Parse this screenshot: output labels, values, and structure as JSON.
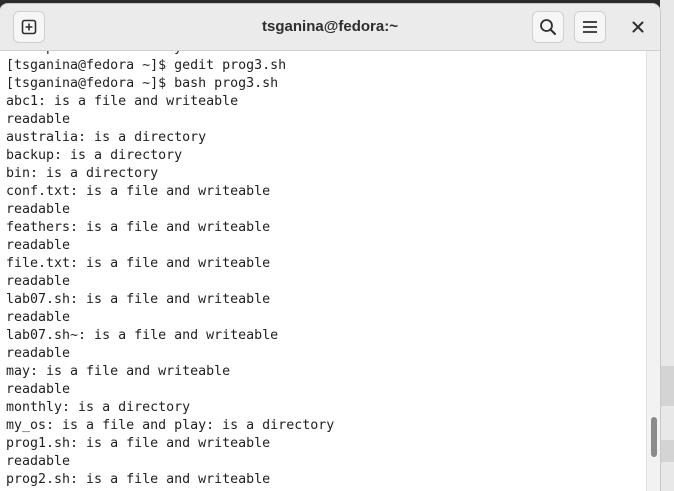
{
  "window": {
    "title": "tsganina@fedora:~"
  },
  "icons": {
    "new_tab": "new-tab-icon",
    "search": "search-icon",
    "menu": "hamburger-menu-icon",
    "close": "close-icon"
  },
  "colors": {
    "headerbar_bg": "#ebebeb",
    "terminal_bg": "#ffffff",
    "terminal_fg": "#1f1f1f",
    "scroll_thumb": "#8a8a8a"
  },
  "terminal": {
    "lines": [
      "backup: is a directory",
      "[tsganina@fedora ~]$ gedit prog3.sh",
      "[tsganina@fedora ~]$ bash prog3.sh",
      "abc1: is a file and writeable",
      "readable",
      "australia: is a directory",
      "backup: is a directory",
      "bin: is a directory",
      "conf.txt: is a file and writeable",
      "readable",
      "feathers: is a file and writeable",
      "readable",
      "file.txt: is a file and writeable",
      "readable",
      "lab07.sh: is a file and writeable",
      "readable",
      "lab07.sh~: is a file and writeable",
      "readable",
      "may: is a file and writeable",
      "readable",
      "monthly: is a directory",
      "my_os: is a file and play: is a directory",
      "prog1.sh: is a file and writeable",
      "readable",
      "prog2.sh: is a file and writeable"
    ]
  }
}
